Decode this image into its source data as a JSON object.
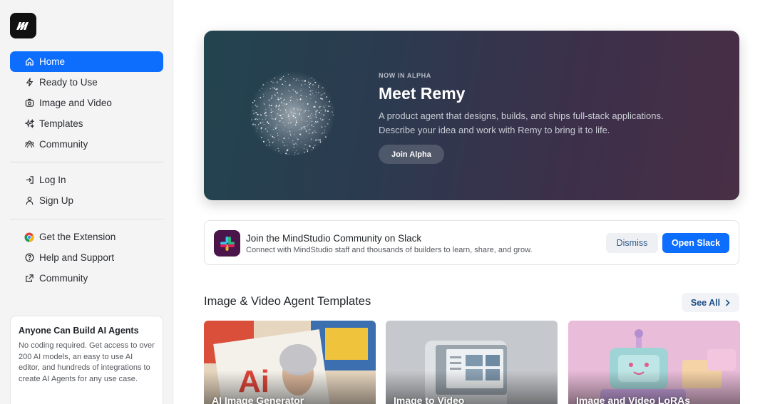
{
  "sidebar": {
    "primary_nav": [
      {
        "label": "Home",
        "icon": "home-icon",
        "active": true
      },
      {
        "label": "Ready to Use",
        "icon": "bolt-icon"
      },
      {
        "label": "Image and Video",
        "icon": "image-video-icon"
      },
      {
        "label": "Templates",
        "icon": "sparkles-icon"
      },
      {
        "label": "Community",
        "icon": "community-icon"
      }
    ],
    "auth_nav": [
      {
        "label": "Log In",
        "icon": "login-icon"
      },
      {
        "label": "Sign Up",
        "icon": "user-icon"
      }
    ],
    "help_nav": [
      {
        "label": "Get the Extension",
        "icon": "chrome-icon"
      },
      {
        "label": "Help and Support",
        "icon": "help-circle-icon"
      },
      {
        "label": "Community",
        "icon": "external-link-icon"
      }
    ],
    "promo": {
      "title": "Anyone Can Build AI Agents",
      "text": "No coding required. Get access to over 200 AI models, an easy to use AI editor, and hundreds of integrations to create AI Agents for any use case."
    }
  },
  "hero": {
    "kicker": "NOW IN ALPHA",
    "title": "Meet Remy",
    "description": "A product agent that designs, builds, and ships full-stack applications. Describe your idea and work with Remy to bring it to life.",
    "button_label": "Join Alpha"
  },
  "slack_banner": {
    "title": "Join the MindStudio Community on Slack",
    "subtitle": "Connect with MindStudio staff and thousands of builders to learn, share, and grow.",
    "dismiss_label": "Dismiss",
    "open_label": "Open Slack"
  },
  "templates_section": {
    "title": "Image & Video Agent Templates",
    "see_all_label": "See All",
    "cards": [
      {
        "label": "AI Image Generator"
      },
      {
        "label": "Image to Video"
      },
      {
        "label": "Image and Video LoRAs"
      }
    ]
  },
  "colors": {
    "accent": "#0d6efd",
    "sidebar_bg": "#f4f4f5",
    "slack_purple": "#4a154b"
  }
}
